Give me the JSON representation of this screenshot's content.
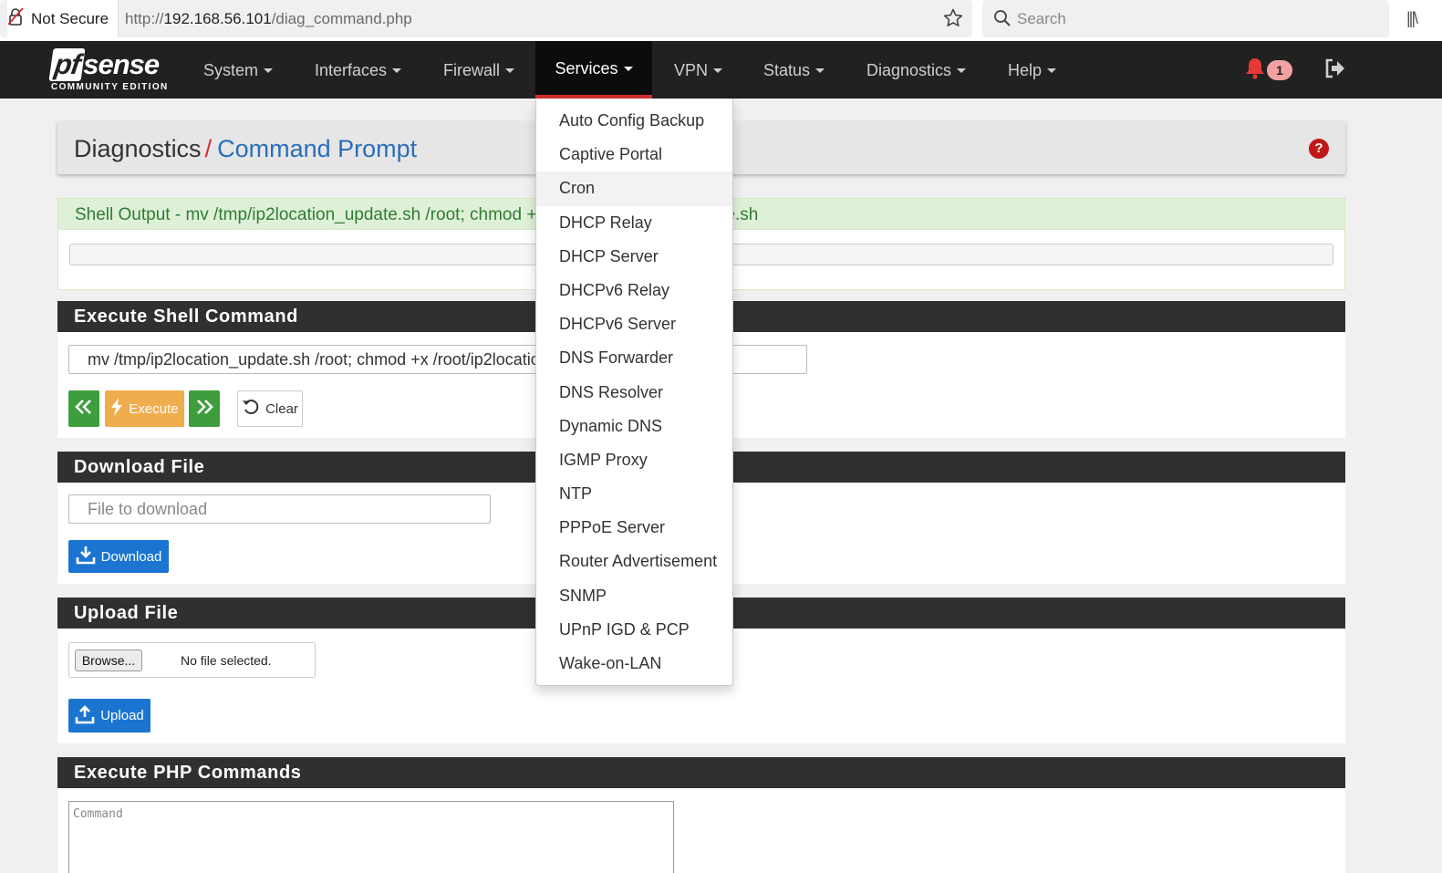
{
  "browser": {
    "security_label": "Not Secure",
    "url_prefix": "http://",
    "url_host": "192.168.56.101",
    "url_path": "/diag_command.php",
    "search_placeholder": "Search"
  },
  "nav": {
    "logo_main": "sense",
    "logo_pf": "pf",
    "logo_sub": "COMMUNITY EDITION",
    "items": [
      {
        "label": "System"
      },
      {
        "label": "Interfaces"
      },
      {
        "label": "Firewall"
      },
      {
        "label": "Services"
      },
      {
        "label": "VPN"
      },
      {
        "label": "Status"
      },
      {
        "label": "Diagnostics"
      },
      {
        "label": "Help"
      }
    ],
    "active_item": "Services",
    "notification_count": "1"
  },
  "breadcrumb": {
    "parent": "Diagnostics",
    "separator": "/",
    "current": "Command Prompt",
    "help_icon": "?"
  },
  "shell_output": {
    "heading": "Shell Output - mv /tmp/ip2location_update.sh /root; chmod +x /root/ip2location_update.sh",
    "output": ""
  },
  "execute_shell": {
    "heading": "Execute Shell Command",
    "command_value": "mv /tmp/ip2location_update.sh /root; chmod +x /root/ip2location_update.sh",
    "execute_label": "Execute",
    "clear_label": "Clear"
  },
  "download": {
    "heading": "Download File",
    "placeholder": "File to download",
    "button_label": "Download"
  },
  "upload": {
    "heading": "Upload File",
    "browse_label": "Browse...",
    "no_file_label": "No file selected.",
    "button_label": "Upload"
  },
  "php": {
    "heading": "Execute PHP Commands",
    "placeholder": "Command"
  },
  "services_menu": {
    "items": [
      "Auto Config Backup",
      "Captive Portal",
      "Cron",
      "DHCP Relay",
      "DHCP Server",
      "DHCPv6 Relay",
      "DHCPv6 Server",
      "DNS Forwarder",
      "DNS Resolver",
      "Dynamic DNS",
      "IGMP Proxy",
      "NTP",
      "PPPoE Server",
      "Router Advertisement",
      "SNMP",
      "UPnP IGD & PCP",
      "Wake-on-LAN"
    ],
    "hovered_item": "Cron"
  },
  "colors": {
    "navbar": "#212121",
    "accent_red": "#d32f2f",
    "link_blue": "#2a6ebb",
    "success_green": "#3e9e3e",
    "warning_orange": "#f0ad4e",
    "primary_blue": "#1b75d0"
  }
}
